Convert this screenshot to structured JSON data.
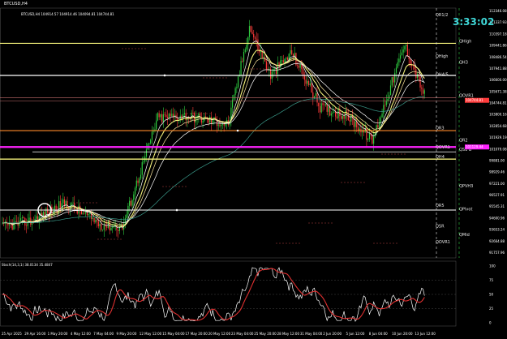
{
  "window": {
    "symbol_title": "BTCUSD,H4",
    "ohlc": "BTCUSD,H4 104914.57 104914.46 104094.81 104744.81",
    "countdown": "3:33:02"
  },
  "colors": {
    "background": "#000000",
    "level_yellow": "#f2f07a",
    "level_white": "#ffffff",
    "level_magenta": "#ff22ff",
    "level_orange": "#ff8a2a",
    "level_red": "#ff3b3b",
    "clock": "#3fd6d6",
    "bull": "#2ecc40",
    "bear": "#ff3b3b",
    "stoch_main": "#ffffff",
    "stoch_signal": "#e03030"
  },
  "levels": [
    {
      "label": "QR1/2",
      "price": 111600
    },
    {
      "label": "QHigh",
      "price": 109441.86
    },
    {
      "label": "QHigh",
      "price": 108200
    },
    {
      "label": "QH3",
      "price": 107700
    },
    {
      "label": "QH4/5",
      "price": 106700
    },
    {
      "label": "QOVR1",
      "price": 104950
    },
    {
      "label": "QR3",
      "price": 102300
    },
    {
      "label": "QR2",
      "price": 101300
    },
    {
      "label": "QOVR1",
      "price": 100700
    },
    {
      "label": "QS1 B",
      "price": 100500
    },
    {
      "label": "QH4",
      "price": 99900
    },
    {
      "label": "QPVH3",
      "price": 97500
    },
    {
      "label": "QR5",
      "price": 95900
    },
    {
      "label": "QPIvot",
      "price": 95600
    },
    {
      "label": "QSR",
      "price": 94200
    },
    {
      "label": "QMid",
      "price": 93500
    },
    {
      "label": "QOVR1",
      "price": 92900
    }
  ],
  "price_axis": [
    "112346.08",
    "111337.93",
    "110397.18",
    "109441.86",
    "108486.54",
    "107941.88",
    "106600.00",
    "105671.38",
    "104744.81",
    "103800.16",
    "102854.68",
    "101929.19",
    "101079.08",
    "99881.00",
    "98929.46",
    "97221.00",
    "96527.91",
    "95545.31",
    "94600.96",
    "93653.24",
    "92664.88",
    "91757.96"
  ],
  "current_price": "104744.81",
  "marker_price": "101129.44",
  "indicator": {
    "title": "Stoch(14,3,1) 38.0134 35.4847",
    "axis": [
      "100",
      "75",
      "50",
      "25",
      "0"
    ]
  },
  "time_axis": [
    "25 Apr 2025",
    "29 Apr 16:00",
    "1 May 20:00",
    "4 May 12:00",
    "7 May 04:00",
    "9 May 20:00",
    "12 May 12:00",
    "15 May 04:00",
    "17 May 20:00",
    "20 May 12:00",
    "23 May 04:00",
    "25 May 20:00",
    "28 May 12:00",
    "31 May 04:00",
    "2 Jun 20:00",
    "5 Jun 12:00",
    "8 Jun 04:00",
    "10 Jun 20:00",
    "13 Jun 12:00"
  ]
}
